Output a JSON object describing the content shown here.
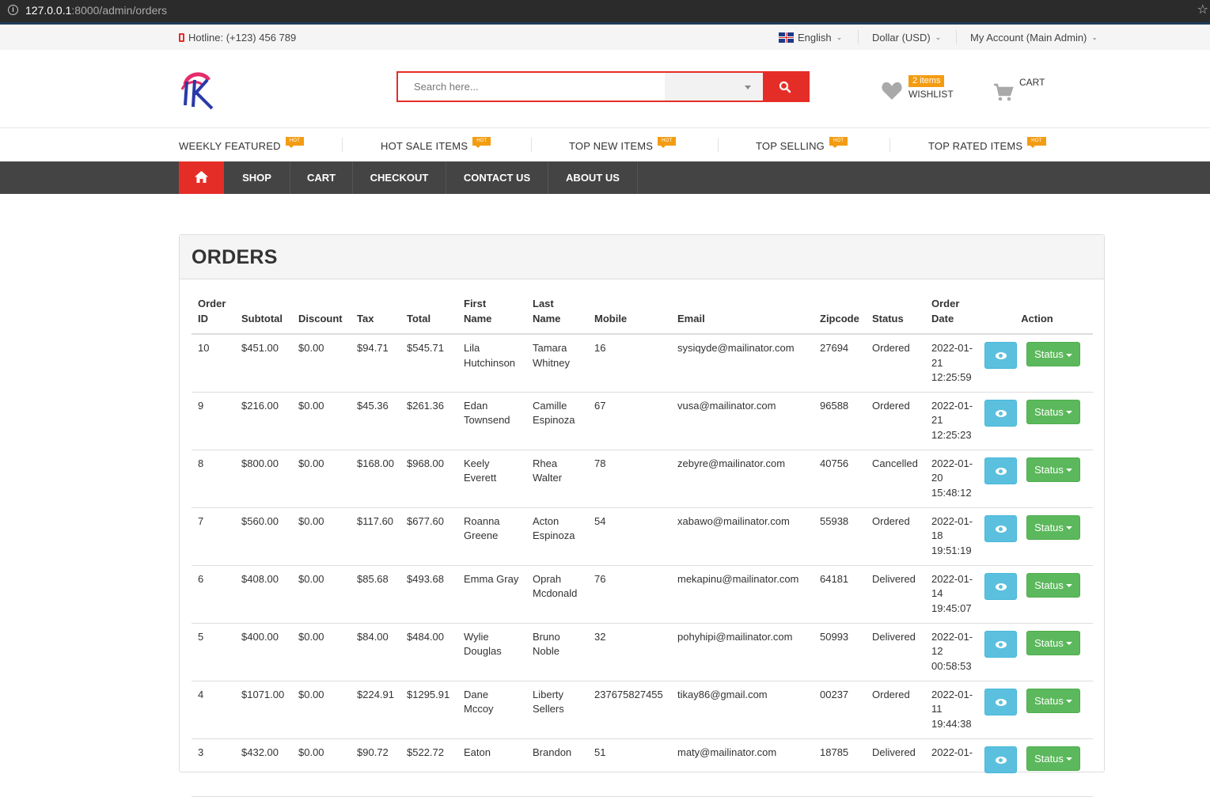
{
  "browser": {
    "url_host": "127.0.0.1",
    "url_path": ":8000/admin/orders"
  },
  "topbar": {
    "hotline": "Hotline: (+123) 456 789",
    "language": "English",
    "currency": "Dollar (USD)",
    "account": "My Account (Main Admin)"
  },
  "header": {
    "search_placeholder": "Search here...",
    "wishlist_badge": "2 items",
    "wishlist_label": "WISHLIST",
    "cart_label": "CART"
  },
  "featured": {
    "hot": "HOT",
    "items": [
      "WEEKLY FEATURED",
      "HOT SALE ITEMS",
      "TOP NEW ITEMS",
      "TOP SELLING",
      "TOP RATED ITEMS"
    ]
  },
  "nav": {
    "items": [
      "SHOP",
      "CART",
      "CHECKOUT",
      "CONTACT US",
      "ABOUT US"
    ]
  },
  "orders": {
    "title": "ORDERS",
    "headers": {
      "order_id": [
        "Order",
        "ID"
      ],
      "subtotal": "Subtotal",
      "discount": "Discount",
      "tax": "Tax",
      "total": "Total",
      "first_name": [
        "First",
        "Name"
      ],
      "last_name": [
        "Last",
        "Name"
      ],
      "mobile": "Mobile",
      "email": "Email",
      "zipcode": "Zipcode",
      "status": "Status",
      "order_date": [
        "Order",
        "Date"
      ],
      "action": "Action"
    },
    "status_button": "Status",
    "rows": [
      {
        "id": "10",
        "subtotal": "$451.00",
        "discount": "$0.00",
        "tax": "$94.71",
        "total": "$545.71",
        "first": [
          "Lila",
          "Hutchinson"
        ],
        "last": [
          "Tamara",
          "Whitney"
        ],
        "mobile": "16",
        "email": "sysiqyde@mailinator.com",
        "zip": "27694",
        "status": "Ordered",
        "date": [
          "2022-01-",
          "21",
          "12:25:59"
        ]
      },
      {
        "id": "9",
        "subtotal": "$216.00",
        "discount": "$0.00",
        "tax": "$45.36",
        "total": "$261.36",
        "first": [
          "Edan",
          "Townsend"
        ],
        "last": [
          "Camille",
          "Espinoza"
        ],
        "mobile": "67",
        "email": "vusa@mailinator.com",
        "zip": "96588",
        "status": "Ordered",
        "date": [
          "2022-01-",
          "21",
          "12:25:23"
        ]
      },
      {
        "id": "8",
        "subtotal": "$800.00",
        "discount": "$0.00",
        "tax": "$168.00",
        "total": "$968.00",
        "first": [
          "Keely",
          "Everett"
        ],
        "last": [
          "Rhea",
          "Walter"
        ],
        "mobile": "78",
        "email": "zebyre@mailinator.com",
        "zip": "40756",
        "status": "Cancelled",
        "date": [
          "2022-01-",
          "20",
          "15:48:12"
        ]
      },
      {
        "id": "7",
        "subtotal": "$560.00",
        "discount": "$0.00",
        "tax": "$117.60",
        "total": "$677.60",
        "first": [
          "Roanna",
          "Greene"
        ],
        "last": [
          "Acton",
          "Espinoza"
        ],
        "mobile": "54",
        "email": "xabawo@mailinator.com",
        "zip": "55938",
        "status": "Ordered",
        "date": [
          "2022-01-",
          "18",
          "19:51:19"
        ]
      },
      {
        "id": "6",
        "subtotal": "$408.00",
        "discount": "$0.00",
        "tax": "$85.68",
        "total": "$493.68",
        "first": [
          "Emma Gray",
          ""
        ],
        "last": [
          "Oprah",
          "Mcdonald"
        ],
        "mobile": "76",
        "email": "mekapinu@mailinator.com",
        "zip": "64181",
        "status": "Delivered",
        "date": [
          "2022-01-",
          "14",
          "19:45:07"
        ]
      },
      {
        "id": "5",
        "subtotal": "$400.00",
        "discount": "$0.00",
        "tax": "$84.00",
        "total": "$484.00",
        "first": [
          "Wylie",
          "Douglas"
        ],
        "last": [
          "Bruno",
          "Noble"
        ],
        "mobile": "32",
        "email": "pohyhipi@mailinator.com",
        "zip": "50993",
        "status": "Delivered",
        "date": [
          "2022-01-",
          "12",
          "00:58:53"
        ]
      },
      {
        "id": "4",
        "subtotal": "$1071.00",
        "discount": "$0.00",
        "tax": "$224.91",
        "total": "$1295.91",
        "first": [
          "Dane",
          "Mccoy"
        ],
        "last": [
          "Liberty",
          "Sellers"
        ],
        "mobile": "237675827455",
        "email": "tikay86@gmail.com",
        "zip": "00237",
        "status": "Ordered",
        "date": [
          "2022-01-",
          "11",
          "19:44:38"
        ]
      },
      {
        "id": "3",
        "subtotal": "$432.00",
        "discount": "$0.00",
        "tax": "$90.72",
        "total": "$522.72",
        "first": [
          "Eaton",
          ""
        ],
        "last": [
          "Brandon",
          ""
        ],
        "mobile": "51",
        "email": "maty@mailinator.com",
        "zip": "18785",
        "status": "Delivered",
        "date": [
          "2022-01-",
          "",
          ""
        ]
      }
    ]
  },
  "colors": {
    "accent": "#e52d27",
    "nav_bg": "#444444",
    "hot_badge": "#f39c12",
    "view_btn": "#5bc0de",
    "status_btn": "#5cb85c"
  }
}
